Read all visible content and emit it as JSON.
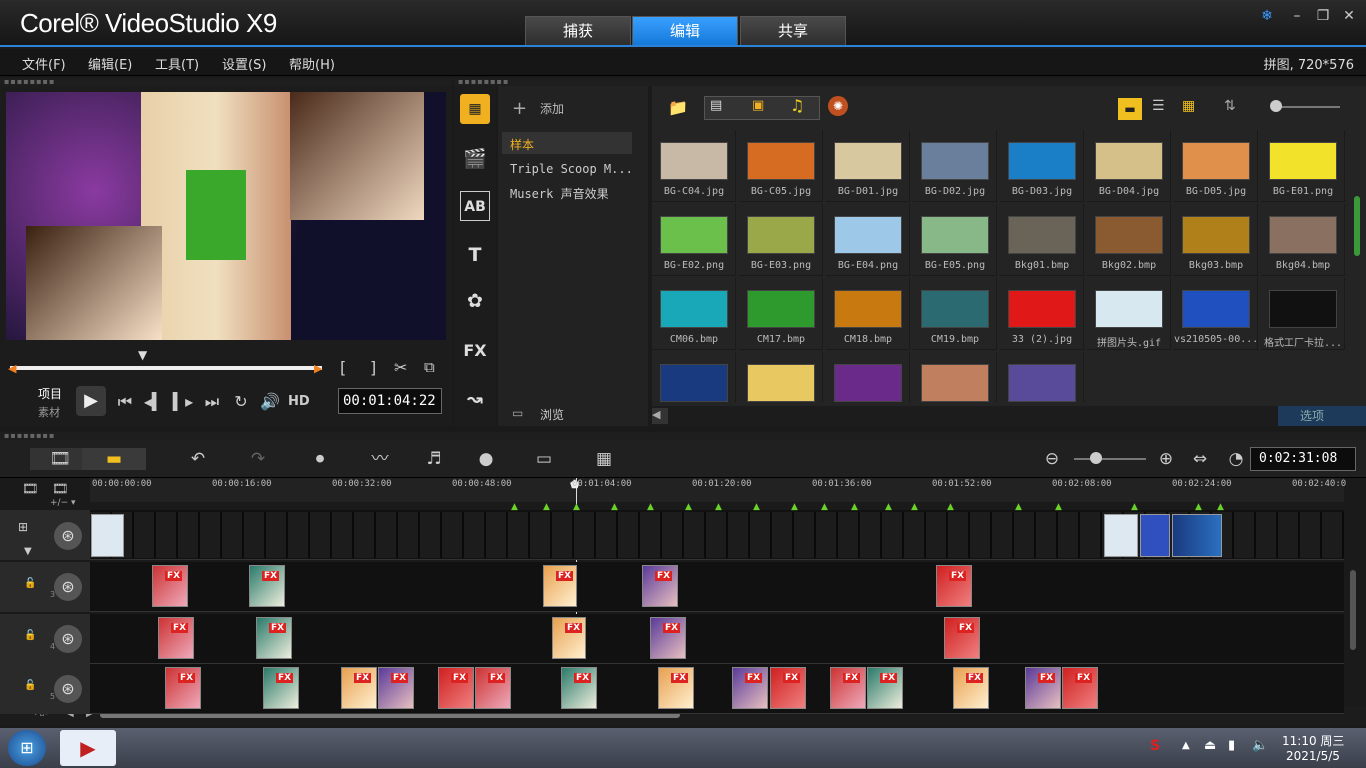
{
  "app": {
    "logo": "Corel® VideoStudio X9"
  },
  "tabs": [
    {
      "label": "捕获"
    },
    {
      "label": "编辑"
    },
    {
      "label": "共享"
    }
  ],
  "menu": [
    "文件(F)",
    "编辑(E)",
    "工具(T)",
    "设置(S)",
    "帮助(H)"
  ],
  "project_info": "拼图, 720*576",
  "player": {
    "mode_project": "项目",
    "mode_clip": "素材",
    "hd": "HD",
    "timecode": "00:01:04:22"
  },
  "library": {
    "add_label": "添加",
    "tree": [
      "样本",
      "Triple Scoop M...",
      "Muserk 声音效果"
    ],
    "browse": "浏览",
    "options": "选项",
    "thumbs": [
      {
        "label": "BG-C04.jpg",
        "color": "#c8b9a6"
      },
      {
        "label": "BG-C05.jpg",
        "color": "#d66b22"
      },
      {
        "label": "BG-D01.jpg",
        "color": "#d8c8a0"
      },
      {
        "label": "BG-D02.jpg",
        "color": "#6a7f9c"
      },
      {
        "label": "BG-D03.jpg",
        "color": "#1b7fc8"
      },
      {
        "label": "BG-D04.jpg",
        "color": "#d6c08a"
      },
      {
        "label": "BG-D05.jpg",
        "color": "#e0904a"
      },
      {
        "label": "BG-E01.png",
        "color": "#f2e22a"
      },
      {
        "label": "BG-E02.png",
        "color": "#6bc04b"
      },
      {
        "label": "BG-E03.png",
        "color": "#9aa84a"
      },
      {
        "label": "BG-E04.png",
        "color": "#9ec8e8"
      },
      {
        "label": "BG-E05.png",
        "color": "#88b888"
      },
      {
        "label": "Bkg01.bmp",
        "color": "#6a6458"
      },
      {
        "label": "Bkg02.bmp",
        "color": "#8a5a30"
      },
      {
        "label": "Bkg03.bmp",
        "color": "#b0801a"
      },
      {
        "label": "Bkg04.bmp",
        "color": "#8a7060"
      },
      {
        "label": "CM06.bmp",
        "color": "#18a8b8"
      },
      {
        "label": "CM17.bmp",
        "color": "#2e9a2e"
      },
      {
        "label": "CM18.bmp",
        "color": "#c87a10"
      },
      {
        "label": "CM19.bmp",
        "color": "#2a6a70"
      },
      {
        "label": "33 (2).jpg",
        "color": "#e01818"
      },
      {
        "label": "拼图片头.gif",
        "color": "#d8e8f0"
      },
      {
        "label": "vs210505-00...",
        "color": "#2050c0"
      },
      {
        "label": "格式工厂卡拉...",
        "color": "#111111"
      },
      {
        "label": "",
        "color": "#1a3a80"
      },
      {
        "label": "",
        "color": "#e8c860"
      },
      {
        "label": "",
        "color": "#6a2a8a"
      },
      {
        "label": "",
        "color": "#c08060"
      },
      {
        "label": "",
        "color": "#5a4a9a"
      }
    ]
  },
  "timeline": {
    "duration": "0:02:31:08",
    "ticks": [
      "00:00:00:00",
      "00:00:16:00",
      "00:00:32:00",
      "00:00:48:00",
      "00:01:04:00",
      "00:01:20:00",
      "00:01:36:00",
      "00:01:52:00",
      "00:02:08:00",
      "00:02:24:00",
      "00:02:40:0"
    ],
    "track_nums": [
      "3",
      "4",
      "5"
    ]
  },
  "taskbar": {
    "time": "11:10 周三",
    "date": "2021/5/5"
  }
}
